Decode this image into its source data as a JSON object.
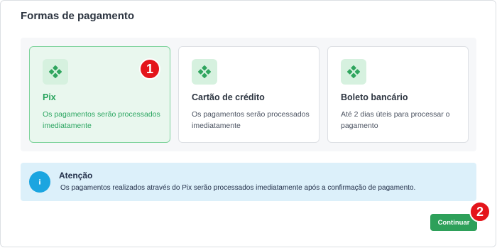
{
  "page": {
    "title": "Formas de pagamento"
  },
  "payment_options": [
    {
      "title": "Pix",
      "description": "Os pagamentos serão processados imediatamente",
      "selected": true,
      "icon": "pix-icon"
    },
    {
      "title": "Cartão de crédito",
      "description": "Os pagamentos serão processados imediatamente",
      "selected": false,
      "icon": "pix-icon"
    },
    {
      "title": "Boleto bancário",
      "description": "Até 2 dias úteis para processar o pagamento",
      "selected": false,
      "icon": "pix-icon"
    }
  ],
  "alert": {
    "title": "Atenção",
    "text": "Os pagamentos realizados através do Pix serão processados imediatamente após a confirmação de pagamento.",
    "icon": "info-icon"
  },
  "actions": {
    "continue_label": "Continuar"
  },
  "annotations": {
    "badge_1": "1",
    "badge_2": "2"
  },
  "colors": {
    "accent_green": "#2ea05a",
    "selected_bg": "#e9f7ee",
    "info_blue": "#1ba5e0",
    "alert_bg": "#dcf0fa",
    "badge_red": "#e4151b"
  }
}
